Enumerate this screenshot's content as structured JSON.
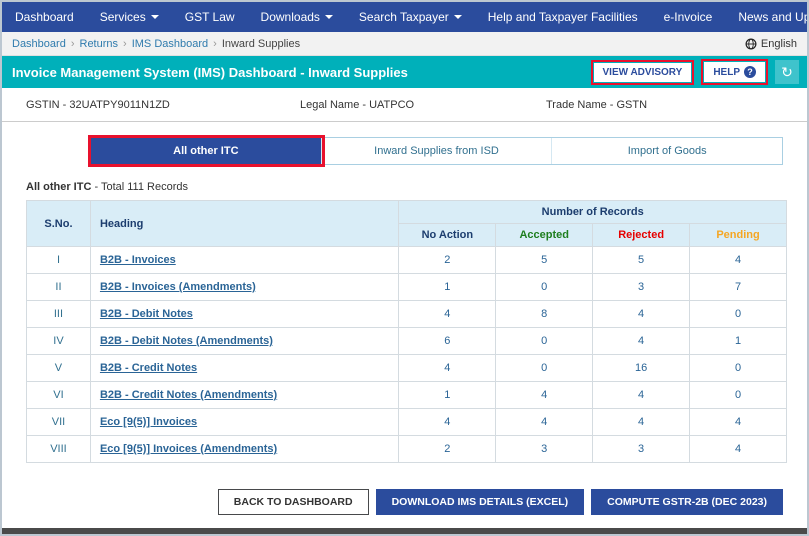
{
  "nav": {
    "items": [
      {
        "label": "Dashboard",
        "has_dropdown": false
      },
      {
        "label": "Services",
        "has_dropdown": true
      },
      {
        "label": "GST Law",
        "has_dropdown": false
      },
      {
        "label": "Downloads",
        "has_dropdown": true
      },
      {
        "label": "Search Taxpayer",
        "has_dropdown": true
      },
      {
        "label": "Help and Taxpayer Facilities",
        "has_dropdown": false
      },
      {
        "label": "e-Invoice",
        "has_dropdown": false
      },
      {
        "label": "News and Updates",
        "has_dropdown": false
      }
    ]
  },
  "breadcrumb": {
    "items": [
      "Dashboard",
      "Returns",
      "IMS Dashboard",
      "Inward Supplies"
    ],
    "language": "English"
  },
  "header": {
    "title": "Invoice Management System (IMS) Dashboard - Inward Supplies",
    "view_advisory": "VIEW ADVISORY",
    "help": "HELP",
    "help_badge": "?",
    "refresh_icon": "↻"
  },
  "info": {
    "gstin": "GSTIN - 32UATPY9011N1ZD",
    "legal_name": "Legal Name - UATPCO",
    "trade_name": "Trade Name - GSTN"
  },
  "tabs": [
    {
      "label": "All other ITC",
      "active": true
    },
    {
      "label": "Inward Supplies from ISD",
      "active": false
    },
    {
      "label": "Import of Goods",
      "active": false
    }
  ],
  "summary": {
    "title": "All other ITC",
    "text": " - Total 111 Records"
  },
  "table": {
    "sno_header": "S.No.",
    "heading_header": "Heading",
    "group_header": "Number of Records",
    "columns": [
      "No Action",
      "Accepted",
      "Rejected",
      "Pending"
    ],
    "rows": [
      {
        "sno": "I",
        "heading": "B2B - Invoices",
        "values": [
          2,
          5,
          5,
          4
        ]
      },
      {
        "sno": "II",
        "heading": "B2B - Invoices (Amendments)",
        "values": [
          1,
          0,
          3,
          7
        ]
      },
      {
        "sno": "III",
        "heading": "B2B - Debit Notes",
        "values": [
          4,
          8,
          4,
          0
        ]
      },
      {
        "sno": "IV",
        "heading": "B2B - Debit Notes (Amendments)",
        "values": [
          6,
          0,
          4,
          1
        ]
      },
      {
        "sno": "V",
        "heading": "B2B - Credit Notes",
        "values": [
          4,
          0,
          16,
          0
        ]
      },
      {
        "sno": "VI",
        "heading": "B2B - Credit Notes (Amendments)",
        "values": [
          1,
          4,
          4,
          0
        ]
      },
      {
        "sno": "VII",
        "heading": "Eco [9(5)] Invoices",
        "values": [
          4,
          4,
          4,
          4
        ]
      },
      {
        "sno": "VIII",
        "heading": "Eco [9(5)] Invoices (Amendments)",
        "values": [
          2,
          3,
          3,
          4
        ]
      }
    ]
  },
  "footer": {
    "back": "BACK TO DASHBOARD",
    "download": "DOWNLOAD IMS DETAILS (EXCEL)",
    "compute": "COMPUTE GSTR-2B (DEC 2023)"
  },
  "colors": {
    "navbar": "#2b4c9d",
    "title_band": "#00b0ba",
    "accepted": "#1e7e1e",
    "rejected": "#e60000",
    "pending": "#f5a623",
    "link": "#2a6496",
    "annotation": "#e8112d"
  }
}
